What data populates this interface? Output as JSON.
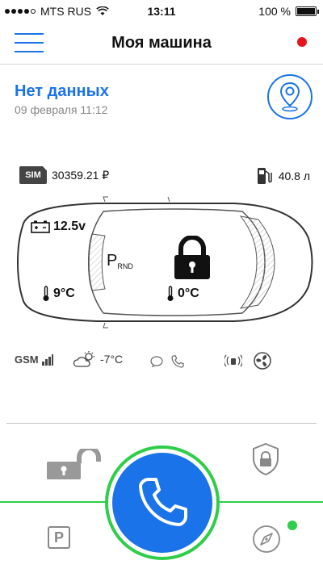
{
  "status_bar": {
    "carrier": "MTS RUS",
    "time": "13:11",
    "battery_text": "100 %",
    "battery_level": 1.0,
    "signal_dots_filled": 4,
    "signal_dots_total": 5
  },
  "nav": {
    "title": "Моя машина",
    "menu_icon": "hamburger-icon",
    "status_color": "#e8141c"
  },
  "info": {
    "title": "Нет данных",
    "date": "09 февраля 11:12",
    "map_icon": "location-pin-icon"
  },
  "car": {
    "sim_label": "SIM",
    "balance": "30359.21 ₽",
    "fuel": "40.8 л",
    "battery_voltage": "12.5v",
    "engine_temp": "9°C",
    "cabin_temp": "0°C",
    "gear_letter": "P",
    "gear_options": "RND",
    "lock_state_icon": "lock-closed-icon"
  },
  "indicators": {
    "gsm_label": "GSM",
    "outside_temp": "-7°C"
  },
  "controls": {
    "parking_label": "P",
    "online_color": "#2fce4a",
    "accent_color": "#1a73e8",
    "green_color": "#2fce4a"
  }
}
